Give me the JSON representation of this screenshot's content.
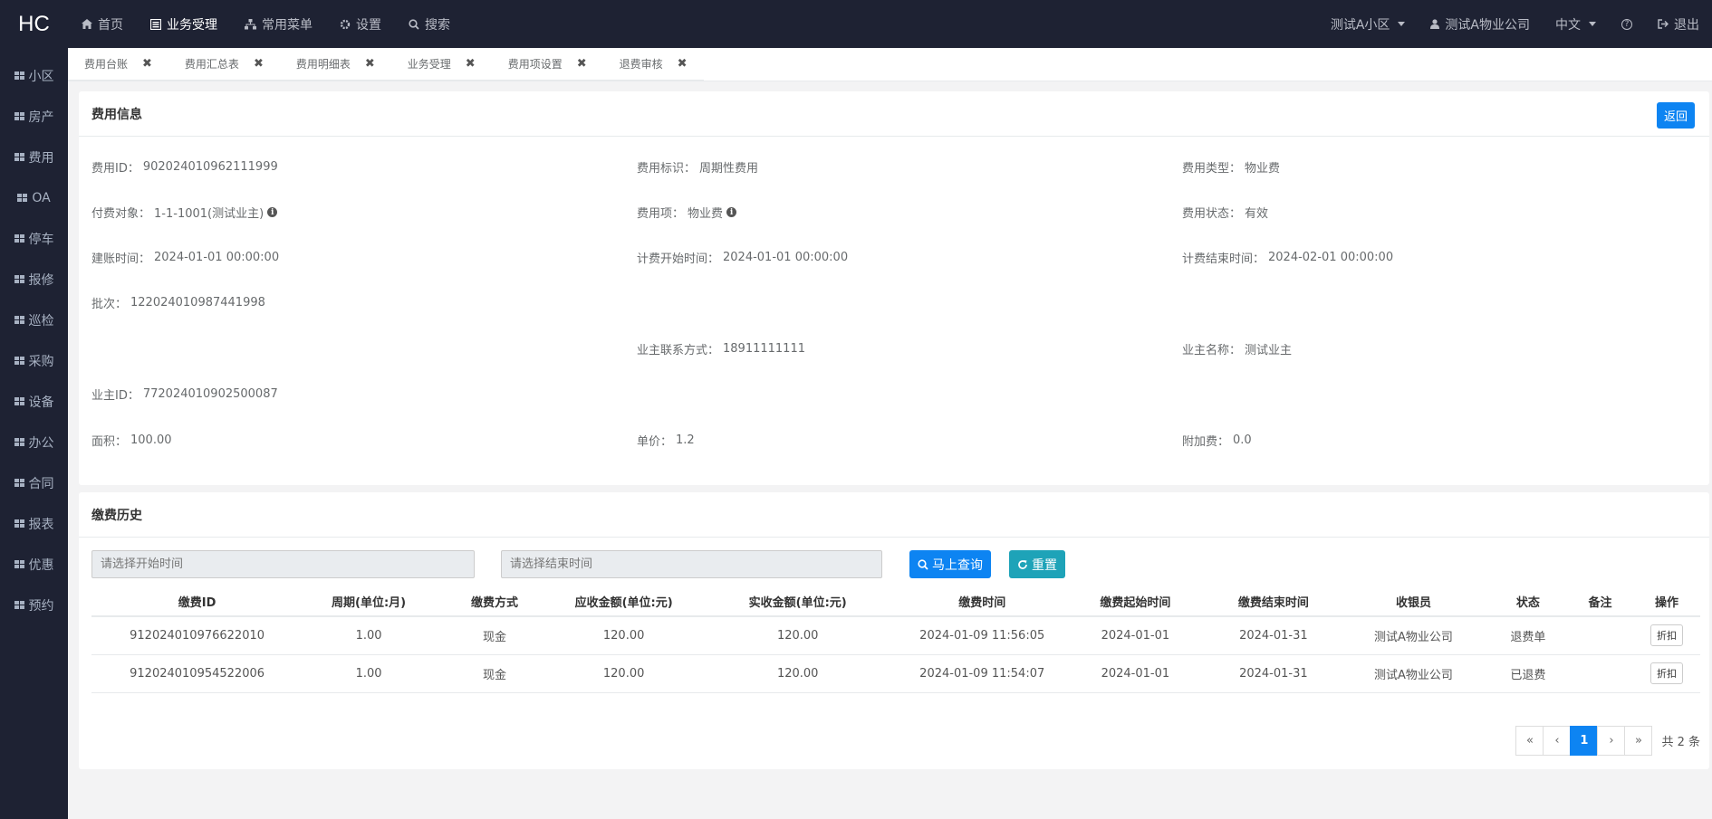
{
  "logo": "HC",
  "topnav": {
    "items": [
      {
        "label": "首页",
        "icon": "home-icon"
      },
      {
        "label": "业务受理",
        "icon": "document-icon"
      },
      {
        "label": "常用菜单",
        "icon": "sitemap-icon"
      },
      {
        "label": "设置",
        "icon": "gear-icon"
      },
      {
        "label": "搜索",
        "icon": "search-icon"
      }
    ],
    "community": "测试A小区",
    "company": "测试A物业公司",
    "language": "中文",
    "help": "?",
    "logout": "退出"
  },
  "sidebar": {
    "items": [
      "小区",
      "房产",
      "费用",
      "OA",
      "停车",
      "报修",
      "巡检",
      "采购",
      "设备",
      "办公",
      "合同",
      "报表",
      "优惠",
      "预约"
    ]
  },
  "tabs": [
    "费用台账",
    "费用汇总表",
    "费用明细表",
    "业务受理",
    "费用项设置",
    "退费审核"
  ],
  "fee_info": {
    "title": "费用信息",
    "return_label": "返回",
    "fields": {
      "fee_id": {
        "label": "费用ID：",
        "value": "902024010962111999"
      },
      "fee_flag": {
        "label": "费用标识：",
        "value": "周期性费用"
      },
      "fee_type": {
        "label": "费用类型：",
        "value": "物业费"
      },
      "payer": {
        "label": "付费对象：",
        "value": "1-1-1001(测试业主)"
      },
      "fee_item": {
        "label": "费用项：",
        "value": "物业费"
      },
      "fee_status": {
        "label": "费用状态：",
        "value": "有效"
      },
      "create_time": {
        "label": "建账时间：",
        "value": "2024-01-01 00:00:00"
      },
      "start_time": {
        "label": "计费开始时间：",
        "value": "2024-01-01 00:00:00"
      },
      "end_time": {
        "label": "计费结束时间：",
        "value": "2024-02-01 00:00:00"
      },
      "batch": {
        "label": "批次：",
        "value": "122024010987441998"
      },
      "owner_contact": {
        "label": "业主联系方式：",
        "value": "18911111111"
      },
      "owner_name": {
        "label": "业主名称：",
        "value": "测试业主"
      },
      "owner_id": {
        "label": "业主ID：",
        "value": "772024010902500087"
      },
      "area": {
        "label": "面积：",
        "value": "100.00"
      },
      "unit_price": {
        "label": "单价：",
        "value": "1.2"
      },
      "extra_fee": {
        "label": "附加费：",
        "value": "0.0"
      }
    }
  },
  "history": {
    "title": "缴费历史",
    "start_placeholder": "请选择开始时间",
    "end_placeholder": "请选择结束时间",
    "query_label": "马上查询",
    "reset_label": "重置",
    "columns": [
      "缴费ID",
      "周期(单位:月)",
      "缴费方式",
      "应收金额(单位:元)",
      "实收金额(单位:元)",
      "缴费时间",
      "缴费起始时间",
      "缴费结束时间",
      "收银员",
      "状态",
      "备注",
      "操作"
    ],
    "rows": [
      {
        "id": "912024010976622010",
        "period": "1.00",
        "method": "现金",
        "receivable": "120.00",
        "received": "120.00",
        "time": "2024-01-09 11:56:05",
        "start": "2024-01-01",
        "end": "2024-01-31",
        "cashier": "测试A物业公司",
        "status": "退费单",
        "note": "",
        "action": "折扣"
      },
      {
        "id": "912024010954522006",
        "period": "1.00",
        "method": "现金",
        "receivable": "120.00",
        "received": "120.00",
        "time": "2024-01-09 11:54:07",
        "start": "2024-01-01",
        "end": "2024-01-31",
        "cashier": "测试A物业公司",
        "status": "已退费",
        "note": "",
        "action": "折扣"
      }
    ],
    "pager": {
      "first": "«",
      "prev": "‹",
      "current": "1",
      "next": "›",
      "last": "»",
      "total": "共 2 条"
    }
  }
}
